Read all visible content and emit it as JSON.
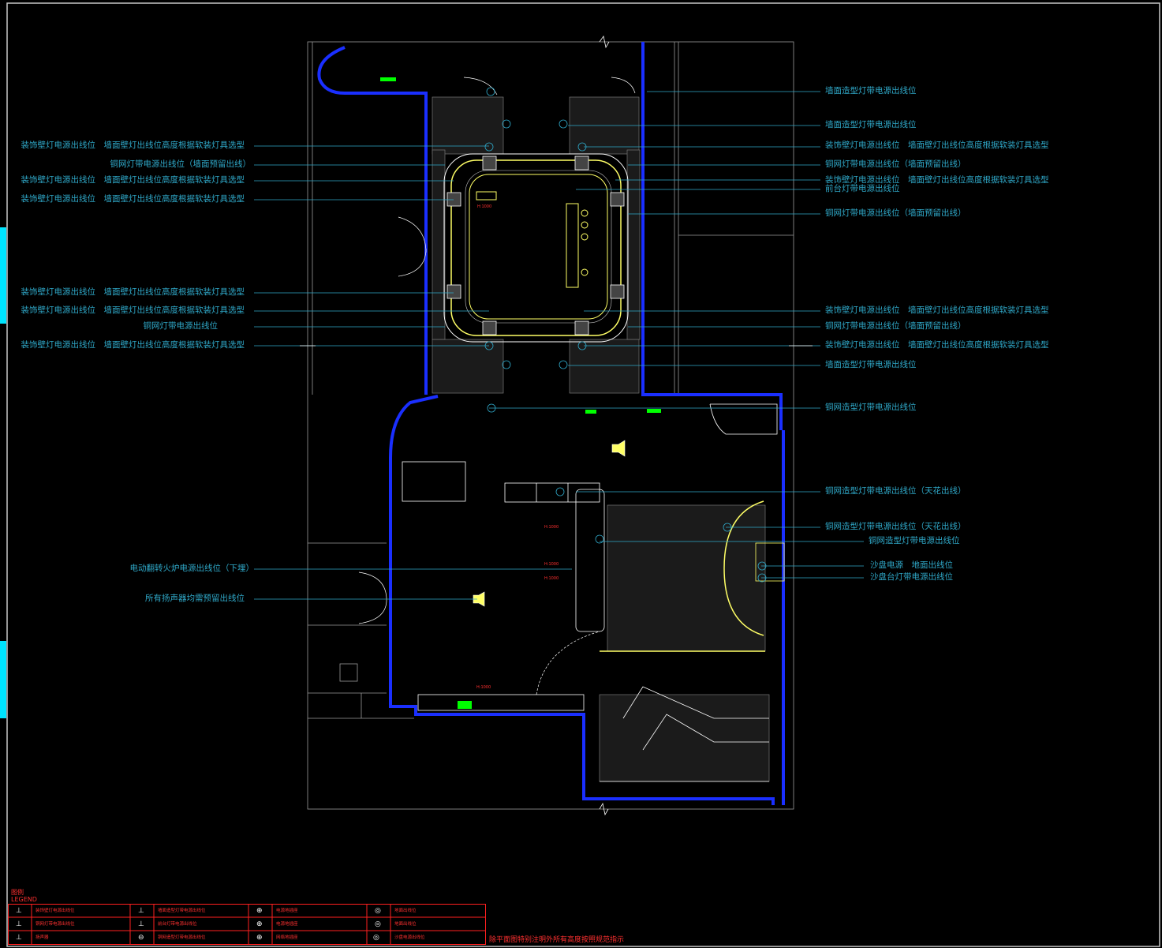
{
  "colors": {
    "background": "#000000",
    "wall": "#1a2fff",
    "outline": "#ffffff",
    "fixture": "#ffff66",
    "label": "#2fa8c8",
    "legend": "#ff2020",
    "accent_green": "#00ff00"
  },
  "labels_right": [
    "墙面造型灯带电源出线位",
    "墙面造型灯带电源出线位",
    "装饰壁灯电源出线位　墙面壁灯出线位高度根据软装灯具选型",
    "铜网灯带电源出线位（墙面预留出线）",
    "装饰壁灯电源出线位　墙面壁灯出线位高度根据软装灯具选型",
    "前台灯带电源出线位",
    "铜网灯带电源出线位（墙面预留出线）",
    "装饰壁灯电源出线位　墙面壁灯出线位高度根据软装灯具选型",
    "铜网灯带电源出线位（墙面预留出线）",
    "装饰壁灯电源出线位　墙面壁灯出线位高度根据软装灯具选型",
    "墙面造型灯带电源出线位",
    "铜网造型灯带电源出线位",
    "铜网造型灯带电源出线位（天花出线）",
    "铜网造型灯带电源出线位（天花出线）",
    "铜网造型灯带电源出线位",
    "沙盘电源　地面出线位",
    "沙盘台灯带电源出线位"
  ],
  "labels_left": [
    "装饰壁灯电源出线位　墙面壁灯出线位高度根据软装灯具选型",
    "铜网灯带电源出线位（墙面预留出线）",
    "装饰壁灯电源出线位　墙面壁灯出线位高度根据软装灯具选型",
    "装饰壁灯电源出线位　墙面壁灯出线位高度根据软装灯具选型",
    "装饰壁灯电源出线位　墙面壁灯出线位高度根据软装灯具选型",
    "装饰壁灯电源出线位　墙面壁灯出线位高度根据软装灯具选型",
    "铜网灯带电源出线位",
    "装饰壁灯电源出线位　墙面壁灯出线位高度根据软装灯具选型",
    "电动翻转火炉电源出线位（下埋）",
    "所有扬声器均需预留出线位"
  ],
  "height_marks": [
    "H:1000",
    "H:1000",
    "H:1000",
    "H:1000",
    "H:1000"
  ],
  "legend": {
    "title_cn": "图例",
    "title_en": "LEGEND",
    "rows": [
      [
        "装饰壁灯电源出线位",
        "墙面造型灯带电源出线位",
        "电源地插座",
        "地面出线位"
      ],
      [
        "铜网灯带电源出线位",
        "前台灯带电源出线位",
        "电源地插座",
        "地面出线位"
      ],
      [
        "扬声器",
        "铜网造型灯带电源出线位",
        "网络地插座",
        "沙盘电源出线位"
      ]
    ],
    "note": "除平面图特别注明外所有高度按照规范指示"
  }
}
